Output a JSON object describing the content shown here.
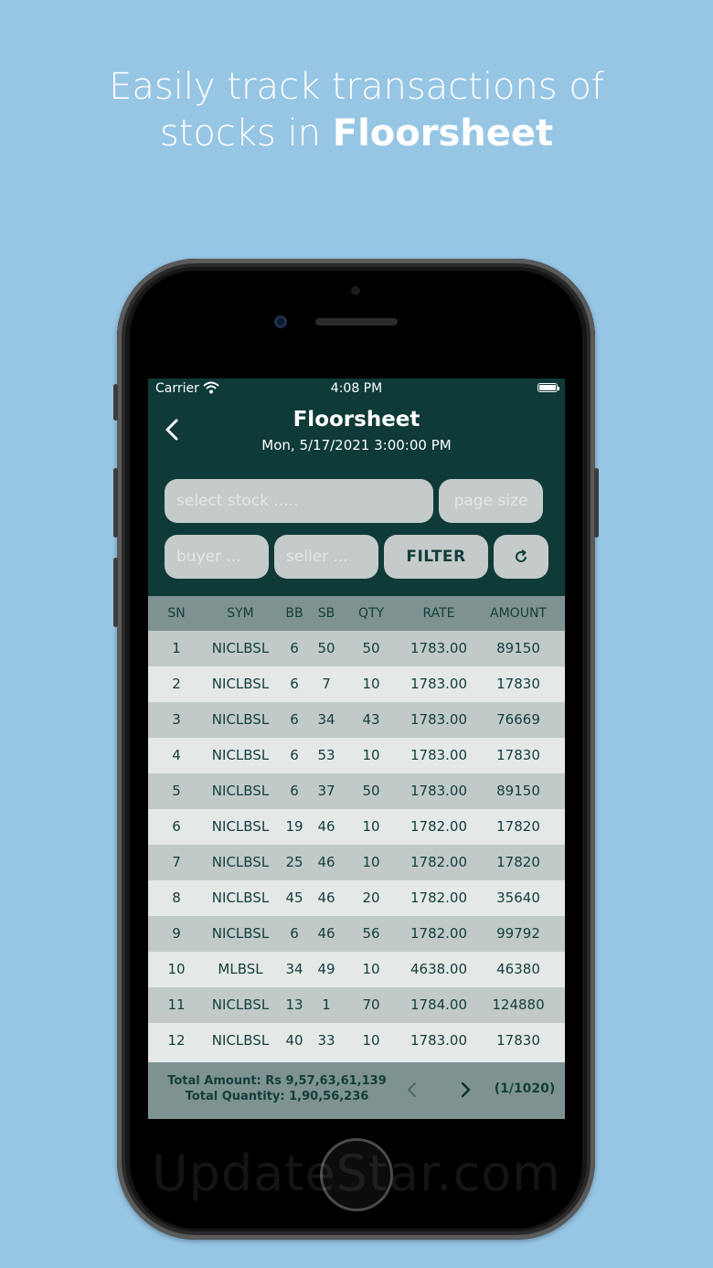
{
  "promo": {
    "line1": "Easily track transactions of",
    "line2_prefix": "stocks in ",
    "line2_bold": "Floorsheet"
  },
  "status_bar": {
    "carrier": "Carrier",
    "time": "4:08 PM"
  },
  "header": {
    "title": "Floorsheet",
    "subtitle": "Mon, 5/17/2021 3:00:00 PM"
  },
  "filters": {
    "stock_placeholder": "select stock .....",
    "page_size_placeholder": "page size",
    "buyer_placeholder": "buyer ...",
    "seller_placeholder": "seller ...",
    "filter_label": "FILTER"
  },
  "table": {
    "columns": [
      "SN",
      "SYM",
      "BB",
      "SB",
      "QTY",
      "RATE",
      "AMOUNT"
    ],
    "rows": [
      [
        "1",
        "NICLBSL",
        "6",
        "50",
        "50",
        "1783.00",
        "89150"
      ],
      [
        "2",
        "NICLBSL",
        "6",
        "7",
        "10",
        "1783.00",
        "17830"
      ],
      [
        "3",
        "NICLBSL",
        "6",
        "34",
        "43",
        "1783.00",
        "76669"
      ],
      [
        "4",
        "NICLBSL",
        "6",
        "53",
        "10",
        "1783.00",
        "17830"
      ],
      [
        "5",
        "NICLBSL",
        "6",
        "37",
        "50",
        "1783.00",
        "89150"
      ],
      [
        "6",
        "NICLBSL",
        "19",
        "46",
        "10",
        "1782.00",
        "17820"
      ],
      [
        "7",
        "NICLBSL",
        "25",
        "46",
        "10",
        "1782.00",
        "17820"
      ],
      [
        "8",
        "NICLBSL",
        "45",
        "46",
        "20",
        "1782.00",
        "35640"
      ],
      [
        "9",
        "NICLBSL",
        "6",
        "46",
        "56",
        "1782.00",
        "99792"
      ],
      [
        "10",
        "MLBSL",
        "34",
        "49",
        "10",
        "4638.00",
        "46380"
      ],
      [
        "11",
        "NICLBSL",
        "13",
        "1",
        "70",
        "1784.00",
        "124880"
      ],
      [
        "12",
        "NICLBSL",
        "40",
        "33",
        "10",
        "1783.00",
        "17830"
      ]
    ]
  },
  "footer": {
    "total_amount": "Total Amount: Rs 9,57,63,61,139",
    "total_quantity": "Total Quantity: 1,90,56,236",
    "page_indicator": "(1/1020)"
  },
  "watermark": "UpdateStar.com",
  "colors": {
    "background": "#97c6e5",
    "header_bg": "#0e3a38",
    "table_head_bg": "#7e9391",
    "row_odd": "#c1cac9",
    "row_even": "#e4e8e7",
    "text_dark": "#133d3b"
  },
  "icons": {
    "back": "chevron-left-icon",
    "refresh": "refresh-icon",
    "prev": "chevron-left-icon",
    "next": "chevron-right-icon",
    "wifi": "wifi-icon",
    "battery": "battery-icon"
  }
}
